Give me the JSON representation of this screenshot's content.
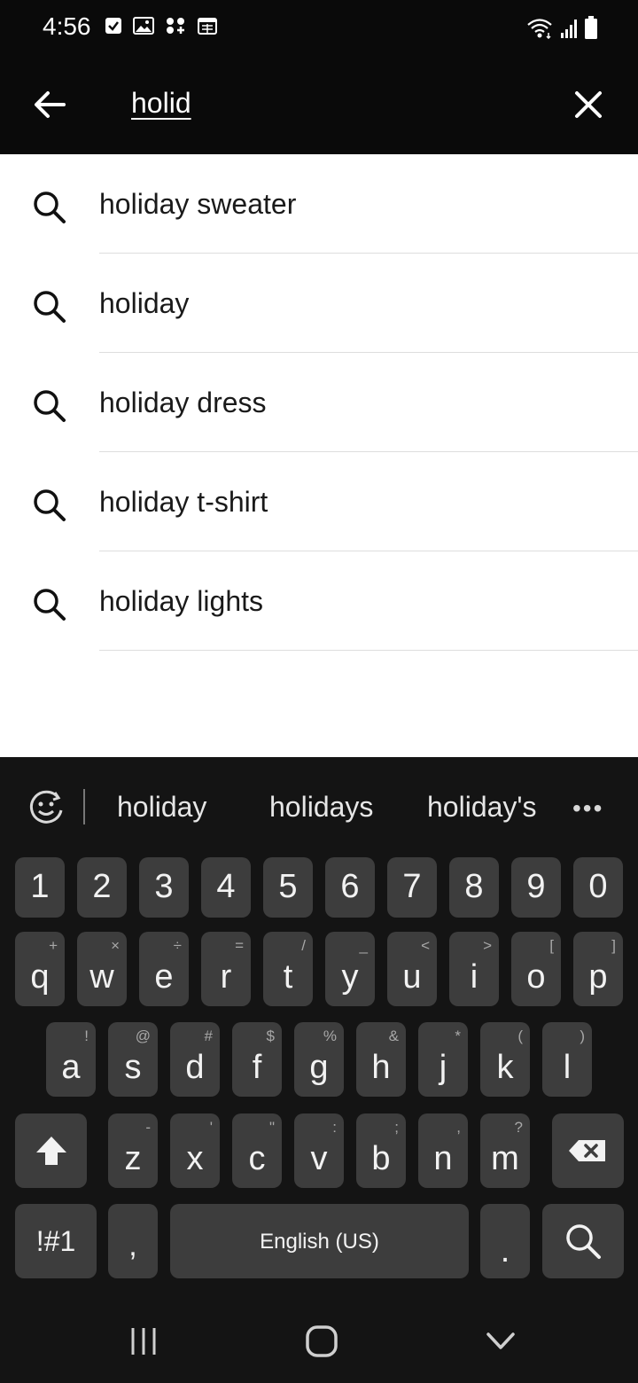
{
  "status_bar": {
    "time": "4:56",
    "left_icons": [
      "checkbox-notification-icon",
      "image-notification-icon",
      "app-grid-notification-icon",
      "calendar-notification-icon"
    ],
    "right_icons": [
      "wifi-icon",
      "signal-icon",
      "battery-icon"
    ]
  },
  "header": {
    "query": "holid",
    "back_icon": "arrow-left-icon",
    "clear_icon": "close-icon"
  },
  "suggestions": [
    {
      "label": "holiday sweater"
    },
    {
      "label": "holiday"
    },
    {
      "label": "holiday dress"
    },
    {
      "label": "holiday t-shirt"
    },
    {
      "label": "holiday lights"
    }
  ],
  "keyboard": {
    "predictions": [
      "holiday",
      "holidays",
      "holiday's"
    ],
    "more_label": "•••",
    "number_row": [
      "1",
      "2",
      "3",
      "4",
      "5",
      "6",
      "7",
      "8",
      "9",
      "0"
    ],
    "row1": [
      {
        "key": "q",
        "sub": "+"
      },
      {
        "key": "w",
        "sub": "×"
      },
      {
        "key": "e",
        "sub": "÷"
      },
      {
        "key": "r",
        "sub": "="
      },
      {
        "key": "t",
        "sub": "/"
      },
      {
        "key": "y",
        "sub": "_"
      },
      {
        "key": "u",
        "sub": "<"
      },
      {
        "key": "i",
        "sub": ">"
      },
      {
        "key": "o",
        "sub": "["
      },
      {
        "key": "p",
        "sub": "]"
      }
    ],
    "row2": [
      {
        "key": "a",
        "sub": "!"
      },
      {
        "key": "s",
        "sub": "@"
      },
      {
        "key": "d",
        "sub": "#"
      },
      {
        "key": "f",
        "sub": "$"
      },
      {
        "key": "g",
        "sub": "%"
      },
      {
        "key": "h",
        "sub": "&"
      },
      {
        "key": "j",
        "sub": "*"
      },
      {
        "key": "k",
        "sub": "("
      },
      {
        "key": "l",
        "sub": ")"
      }
    ],
    "row3": [
      {
        "key": "z",
        "sub": "-"
      },
      {
        "key": "x",
        "sub": "'"
      },
      {
        "key": "c",
        "sub": "\""
      },
      {
        "key": "v",
        "sub": ":"
      },
      {
        "key": "b",
        "sub": ";"
      },
      {
        "key": "n",
        "sub": ","
      },
      {
        "key": "m",
        "sub": "?"
      }
    ],
    "symbols_label": "!#1",
    "comma_label": ",",
    "space_label": "English (US)",
    "period_label": ".",
    "shift_icon": "shift-arrow-icon",
    "backspace_icon": "backspace-icon",
    "search_icon": "search-icon"
  },
  "navbar": {
    "recents_icon": "recents-icon",
    "home_icon": "home-icon",
    "back_icon": "hide-keyboard-icon"
  }
}
